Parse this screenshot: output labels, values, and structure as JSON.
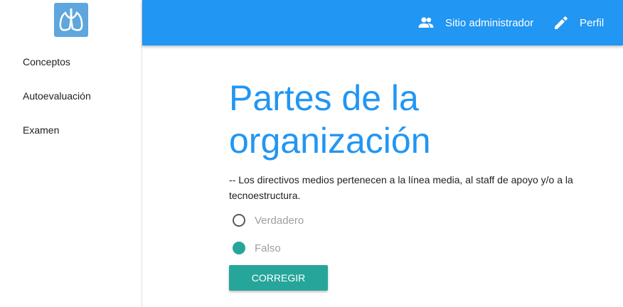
{
  "sidebar": {
    "logo_icon": "lungs-icon",
    "items": [
      {
        "label": "Conceptos"
      },
      {
        "label": "Autoevaluación"
      },
      {
        "label": "Examen"
      }
    ]
  },
  "topbar": {
    "admin": {
      "icon": "group-icon",
      "label": "Sitio administrador"
    },
    "profile": {
      "icon": "pencil-icon",
      "label": "Perfil"
    }
  },
  "main": {
    "title": "Partes de la organización",
    "question": "-- Los directivos medios pertenecen a la línea media, al staff de apoyo y/o a la tecnoestructura.",
    "options": [
      {
        "label": "Verdadero",
        "selected": false
      },
      {
        "label": "Falso",
        "selected": true
      }
    ],
    "submit_label": "CORREGIR"
  },
  "colors": {
    "primary": "#2196f3",
    "accent": "#26a69a"
  }
}
